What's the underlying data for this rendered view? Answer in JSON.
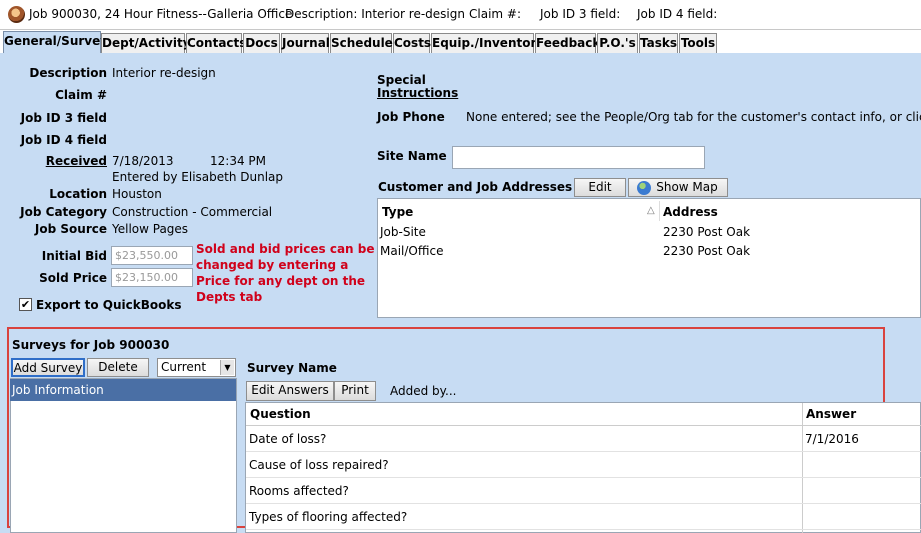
{
  "titlebar": {
    "job": "Job 900030, 24 Hour Fitness--Galleria Office",
    "description": "Description: Interior re-design",
    "claim": "Claim #:",
    "job_id3": "Job ID 3 field:",
    "job_id4": "Job ID 4 field:"
  },
  "tabs": [
    "General/Survey",
    "Dept/Activity",
    "Contacts",
    "Docs",
    "Journal",
    "Schedule",
    "Costs",
    "Equip./Inventory",
    "Feedback",
    "P.O.'s",
    "Tasks",
    "Tools"
  ],
  "general": {
    "description_label": "Description",
    "description_value": "Interior re-design",
    "claim_label": "Claim #",
    "job_id3_label": "Job ID 3 field",
    "job_id4_label": "Job ID 4 field",
    "received_label": "Received",
    "received_date": "7/18/2013",
    "received_time": "12:34 PM",
    "entered_by": "Entered by Elisabeth Dunlap",
    "location_label": "Location",
    "location_value": "Houston",
    "category_label": "Job Category",
    "category_value": "Construction - Commercial",
    "source_label": "Job Source",
    "source_value": "Yellow Pages",
    "initial_bid_label": "Initial Bid",
    "initial_bid_value": "$23,550.00",
    "sold_price_label": "Sold Price",
    "sold_price_value": "$23,150.00",
    "price_note": "Sold and bid prices can be changed by entering a Price for any dept on the Depts tab",
    "export_label": "Export to QuickBooks",
    "export_checked": true
  },
  "right": {
    "special_label_1": "Special",
    "special_label_2": "Instructions",
    "job_phone_label": "Job Phone",
    "job_phone_value": "None entered; see the People/Org tab for the customer's contact info, or click h",
    "site_name_label": "Site Name",
    "site_name_value": "",
    "addresses_label": "Customer and Job Addresses",
    "edit_button": "Edit",
    "show_map_button": "Show Map",
    "address_columns": [
      "Type",
      "Address"
    ],
    "addresses": [
      {
        "type": "Job-Site",
        "address": "2230 Post Oak"
      },
      {
        "type": "Mail/Office",
        "address": "2230 Post Oak"
      }
    ]
  },
  "surveys": {
    "title": "Surveys for Job 900030",
    "add_button": "Add Survey",
    "delete_button": "Delete",
    "filter_value": "Current",
    "list": [
      "Job Information"
    ],
    "survey_name_label": "Survey Name",
    "edit_answers_button": "Edit Answers",
    "print_button": "Print",
    "added_by": "Added by...",
    "columns": [
      "Question",
      "Answer"
    ],
    "rows": [
      {
        "question": "Date of loss?",
        "answer": "7/1/2016"
      },
      {
        "question": "Cause of loss repaired?",
        "answer": ""
      },
      {
        "question": "Rooms affected?",
        "answer": ""
      },
      {
        "question": "Types of flooring affected?",
        "answer": ""
      }
    ]
  },
  "colors": {
    "panel_bg": "#c7dcf3",
    "highlight_red": "#d9433e",
    "note_red": "#d0021b",
    "selection": "#4a6fa5"
  }
}
